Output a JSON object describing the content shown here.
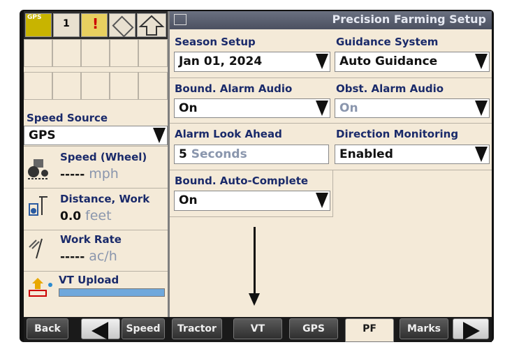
{
  "header": {
    "title": "Precision Farming Setup"
  },
  "icon_bar": {
    "gps_label": "GPS",
    "rate_label": "1"
  },
  "left_panel": {
    "speed_source": {
      "label": "Speed Source",
      "value": "GPS"
    },
    "speed": {
      "label": "Speed (Wheel)",
      "value": "-----",
      "unit": "mph"
    },
    "distance": {
      "label": "Distance, Work",
      "value": "0.0",
      "unit": "feet"
    },
    "work_rate": {
      "label": "Work Rate",
      "value": "-----",
      "unit": "ac/h"
    },
    "vt_upload": {
      "label": "VT Upload",
      "progress": 1.0
    }
  },
  "fields": {
    "season_setup": {
      "label": "Season Setup",
      "value": "Jan 01, 2024"
    },
    "guidance_system": {
      "label": "Guidance System",
      "value": "Auto Guidance"
    },
    "bound_alarm_audio": {
      "label": "Bound. Alarm Audio",
      "value": "On"
    },
    "obst_alarm_audio": {
      "label": "Obst. Alarm Audio",
      "value": "On"
    },
    "alarm_look_ahead": {
      "label": "Alarm Look Ahead",
      "value": "5",
      "unit": "Seconds"
    },
    "direction_monitoring": {
      "label": "Direction Monitoring",
      "value": "Enabled"
    },
    "bound_auto_complete": {
      "label": "Bound. Auto-Complete",
      "value": "On"
    }
  },
  "bottom_bar": {
    "back": "Back",
    "tabs": [
      "Speed",
      "Tractor",
      "VT",
      "GPS",
      "PF",
      "Marks"
    ],
    "selected_tab": "PF"
  },
  "colors": {
    "panel": "#f4ead8",
    "label": "#1a2a6a",
    "header": "#5a6070",
    "progress": "#6fa8dc"
  }
}
